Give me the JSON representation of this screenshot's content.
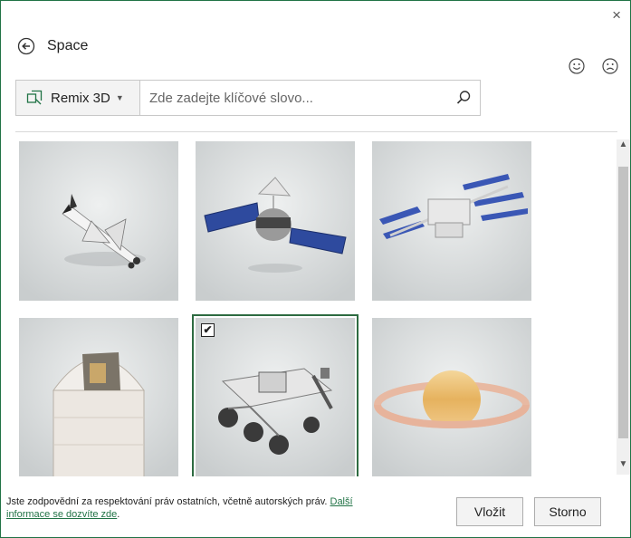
{
  "dialog": {
    "title": "Space",
    "close_glyph": "×"
  },
  "search": {
    "source_label": "Remix 3D",
    "placeholder": "Zde zadejte klíčové slovo...",
    "value": ""
  },
  "results": [
    {
      "name": "space-shuttle",
      "selected": false
    },
    {
      "name": "satellite",
      "selected": false
    },
    {
      "name": "space-station",
      "selected": false
    },
    {
      "name": "observatory-dome",
      "selected": false
    },
    {
      "name": "mars-rover",
      "selected": true,
      "check_glyph": "✔"
    },
    {
      "name": "saturn",
      "selected": false
    }
  ],
  "footer": {
    "notice_text": "Jste zodpovědní za respektování práv ostatních, včetně autorských práv. ",
    "link_text": "Další informace se dozvíte zde",
    "notice_end": ".",
    "insert_label": "Vložit",
    "cancel_label": "Storno"
  },
  "colors": {
    "accent": "#217346",
    "selected_border": "#2d6b41",
    "remix_icon": "#217346"
  },
  "icons": [
    "back-arrow-icon",
    "smile-icon",
    "frown-icon",
    "remix-3d-icon",
    "search-icon",
    "close-icon",
    "chevron-up-icon",
    "chevron-down-icon"
  ]
}
